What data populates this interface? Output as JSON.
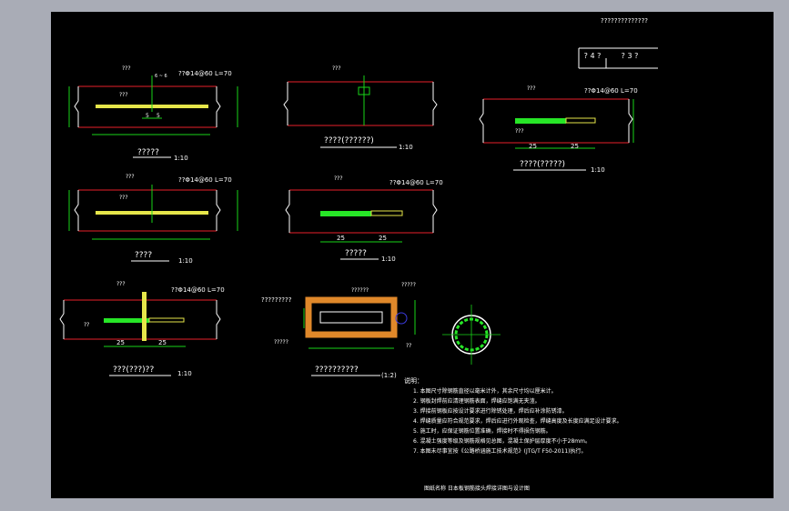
{
  "header": {
    "sheet_title": "??????????????",
    "title_block": [
      "? 4 ?",
      "? 3 ?"
    ]
  },
  "callouts": {
    "weld": "???",
    "weld_steel": "???",
    "rebar_spec": "??Φ14@60 L=70",
    "rebar_spec_alt": "??Φ14@60  L=70",
    "weld_size": "6 ~ 6",
    "long_label": "?????????",
    "steel_label": "??????",
    "short_label": "?????",
    "end_label": "?????",
    "small_label": "??"
  },
  "dims": {
    "five": "5",
    "twenty_five": "25",
    "ratio": "??"
  },
  "details": [
    {
      "title": "?????",
      "scale": "1:10"
    },
    {
      "title": "????(??????)",
      "scale": "1:10"
    },
    {
      "title": "????(?????)",
      "scale": "1:10"
    },
    {
      "title": "????",
      "scale": "1:10"
    },
    {
      "title": "?????",
      "scale": "1:10"
    },
    {
      "title": "???(???)??",
      "scale": "1:10"
    },
    {
      "title": "??????????",
      "scale": "(1:2)"
    }
  ],
  "notes": {
    "heading": "说明：",
    "items": [
      "1. 本图尺寸除钢筋直径以毫米计外，其余尺寸均以厘米计。",
      "2. 钢板封焊前应清理钢筋表面，焊缝应饱满无夹渣。",
      "3. 焊接前钢板应按设计要求进行除锈处理，焊后应补涂防锈漆。",
      "4. 焊缝质量应符合规范要求，焊后应进行外观检查，焊缝高度及长度应满足设计要求。",
      "5. 施工时，应保证钢筋位置准确，焊接时不得损伤钢筋。",
      "6. 混凝土强度等级及钢筋规格见总图，混凝土保护层厚度不小于28mm。",
      "7. 本图未尽事宜按《公路桥涵施工技术规范》(JTG/T F50-2011)执行。"
    ]
  },
  "footer": {
    "caption": "图纸名称  日本板钢筋接头焊接详图与设计图"
  },
  "colors": {
    "background": "#000000",
    "frame": "#a9acb6",
    "line_red": "#e8202a",
    "line_green": "#19d419",
    "line_white": "#ffffff",
    "bar_yellow": "#e6e64a",
    "bar_green": "#27e627",
    "tube_orange": "#e0882a"
  }
}
